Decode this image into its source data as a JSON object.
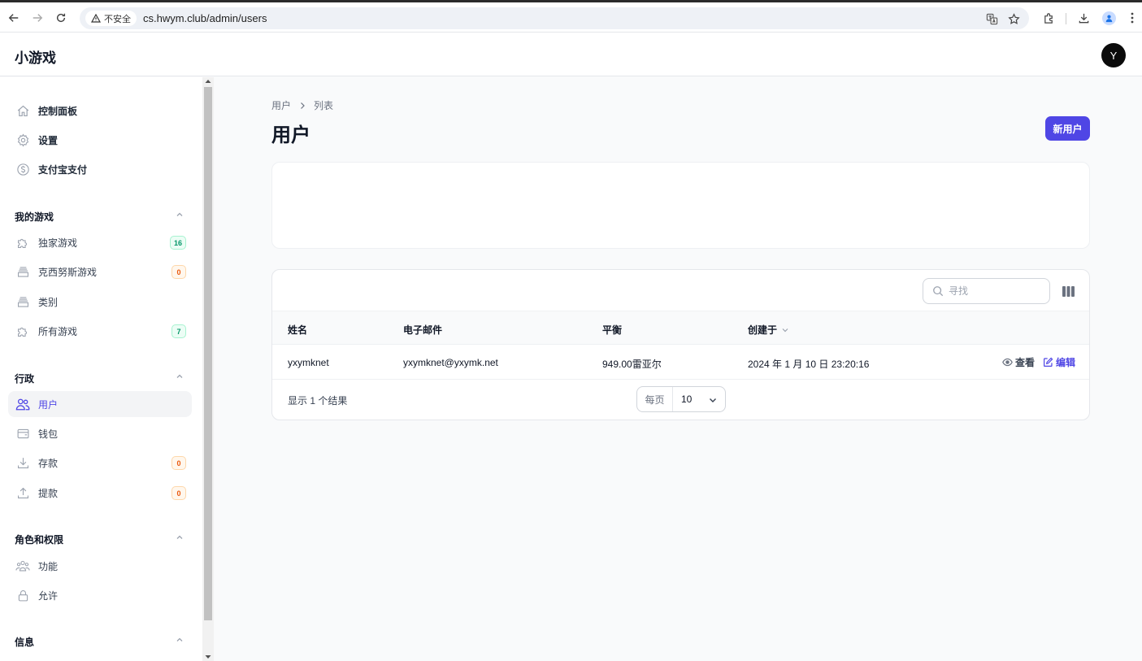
{
  "browser": {
    "security_label": "不安全",
    "url": "cs.hwym.club/admin/users"
  },
  "header": {
    "brand": "小游戏",
    "avatar_initial": "Y"
  },
  "sidebar": {
    "top_items": [
      {
        "label": "控制面板",
        "icon": "home-icon"
      },
      {
        "label": "设置",
        "icon": "gear-icon"
      },
      {
        "label": "支付宝支付",
        "icon": "dollar-circle-icon"
      }
    ],
    "groups": [
      {
        "title": "我的游戏",
        "items": [
          {
            "label": "独家游戏",
            "icon": "puzzle-icon",
            "badge": "16",
            "badge_color": "green"
          },
          {
            "label": "克西努斯游戏",
            "icon": "stack-icon",
            "badge": "0",
            "badge_color": "orange"
          },
          {
            "label": "类别",
            "icon": "stack-icon"
          },
          {
            "label": "所有游戏",
            "icon": "puzzle-icon",
            "badge": "7",
            "badge_color": "green"
          }
        ]
      },
      {
        "title": "行政",
        "items": [
          {
            "label": "用户",
            "icon": "users-icon",
            "active": true
          },
          {
            "label": "钱包",
            "icon": "wallet-icon"
          },
          {
            "label": "存款",
            "icon": "download-icon",
            "badge": "0",
            "badge_color": "orange"
          },
          {
            "label": "提款",
            "icon": "upload-icon",
            "badge": "0",
            "badge_color": "orange"
          }
        ]
      },
      {
        "title": "角色和权限",
        "items": [
          {
            "label": "功能",
            "icon": "user-group-icon"
          },
          {
            "label": "允许",
            "icon": "lock-icon"
          }
        ]
      },
      {
        "title": "信息",
        "items": []
      }
    ]
  },
  "main": {
    "breadcrumb": [
      "用户",
      "列表"
    ],
    "title": "用户",
    "new_button": "新用户",
    "search_placeholder": "寻找",
    "columns": [
      "姓名",
      "电子邮件",
      "平衡",
      "创建于"
    ],
    "rows": [
      {
        "name": "yxymknet",
        "email": "yxymknet@yxymk.net",
        "balance": "949.00雷亚尔",
        "created": "2024 年 1 月 10 日 23:20:16",
        "view_label": "查看",
        "edit_label": "编辑"
      }
    ],
    "results_text": "显示 1 个结果",
    "per_page_label": "每页",
    "per_page_value": "10"
  },
  "colors": {
    "primary": "#4f46e5",
    "badge_green": "#059669",
    "badge_orange": "#ea580c"
  }
}
